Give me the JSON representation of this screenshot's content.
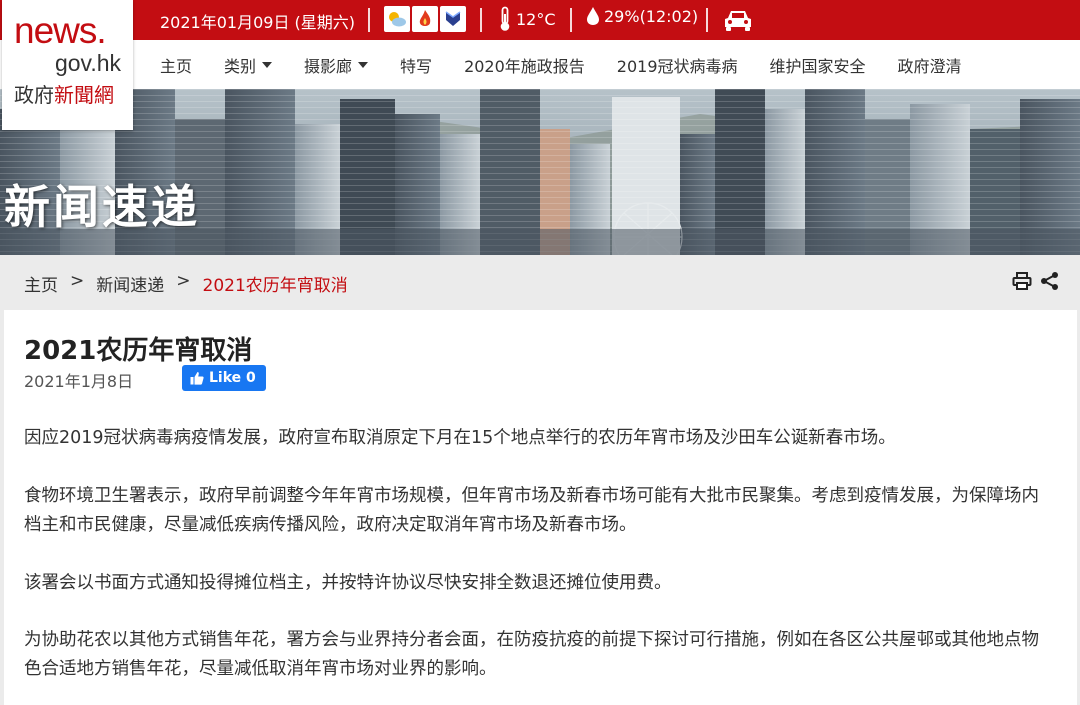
{
  "logo": {
    "line1": "news.",
    "line2": "gov.hk",
    "line3_a": "政府",
    "line3_b": "新聞網"
  },
  "topbar": {
    "date": "2021年01月09日 (星期六)",
    "weather_icons": [
      "sunny-cloud-icon",
      "fire-danger-icon",
      "monsoon-icon"
    ],
    "temperature": "12°C",
    "humidity": "29%(12:02)",
    "traffic_icon": "car-icon"
  },
  "nav": {
    "items": [
      "主页",
      "类别",
      "摄影廊",
      "特写",
      "2020年施政报告",
      "2019冠状病毒病",
      "维护国家安全",
      "政府澄清"
    ]
  },
  "banner": {
    "title": "新闻速递"
  },
  "breadcrumb": {
    "home": "主页",
    "section": "新闻速递",
    "current": "2021农历年宵取消",
    "sep": ">"
  },
  "article": {
    "title": "2021农历年宵取消",
    "date": "2021年1月8日",
    "like_label": "Like 0",
    "paragraphs": [
      "因应2019冠状病毒病疫情发展，政府宣布取消原定下月在15个地点举行的农历年宵市场及沙田车公诞新春市场。",
      "食物环境卫生署表示，政府早前调整今年年宵市场规模，但年宵市场及新春市场可能有大批市民聚集。考虑到疫情发展，为保障场内档主和市民健康，尽量减低疾病传播风险，政府决定取消年宵市场及新春市场。",
      "该署会以书面方式通知投得摊位档主，并按特许协议尽快安排全数退还摊位使用费。",
      "为协助花农以其他方式销售年花，署方会与业界持分者会面，在防疫抗疫的前提下探讨可行措施，例如在各区公共屋邨或其他地点物色合适地方销售年花，尽量减低取消年宵市场对业界的影响。"
    ]
  },
  "colors": {
    "brand_red": "#c30d12",
    "facebook_blue": "#1877f2",
    "page_bg": "#ebebeb"
  }
}
